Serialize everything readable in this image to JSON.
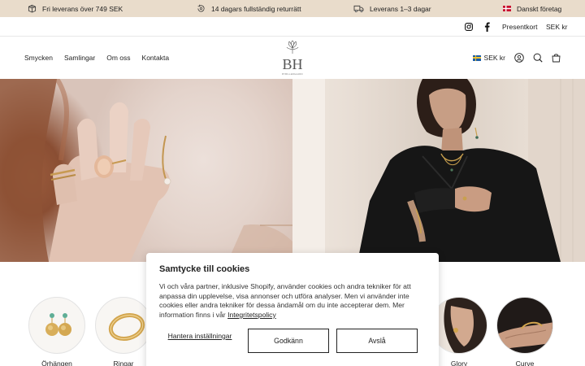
{
  "announcement": {
    "items": [
      {
        "icon": "box-icon",
        "text": "Fri leverans över 749 SEK"
      },
      {
        "icon": "return-icon",
        "text": "14 dagars fullständig returrätt"
      },
      {
        "icon": "truck-icon",
        "text": "Leverans 1–3 dagar"
      },
      {
        "icon": "danish-flag-icon",
        "text": "Danskt företag"
      }
    ]
  },
  "utility": {
    "gift_card": "Presentkort",
    "currency": "SEK kr"
  },
  "header": {
    "nav": [
      "Smycken",
      "Samlingar",
      "Om oss",
      "Kontakta"
    ],
    "logo_text": "BH",
    "logo_subtext": "BYBILLEDGAARD",
    "currency": "SEK kr"
  },
  "collections": [
    {
      "label": "Örhängen"
    },
    {
      "label": "Ringar"
    },
    {
      "label": "Glory"
    },
    {
      "label": "Curve"
    }
  ],
  "cookie": {
    "title": "Samtycke till cookies",
    "body": "Vi och våra partner, inklusive Shopify, använder cookies och andra tekniker för att anpassa din upplevelse, visa annonser och utföra analyser. Men vi använder inte cookies eller andra tekniker för dessa ändamål om du inte accepterar dem. Mer information finns i vår ",
    "policy_link": "Integritetspolicy",
    "manage": "Hantera inställningar",
    "accept": "Godkänn",
    "decline": "Avslå"
  },
  "colors": {
    "announcement_bg": "#e9dccb",
    "text": "#1f1f1f"
  }
}
